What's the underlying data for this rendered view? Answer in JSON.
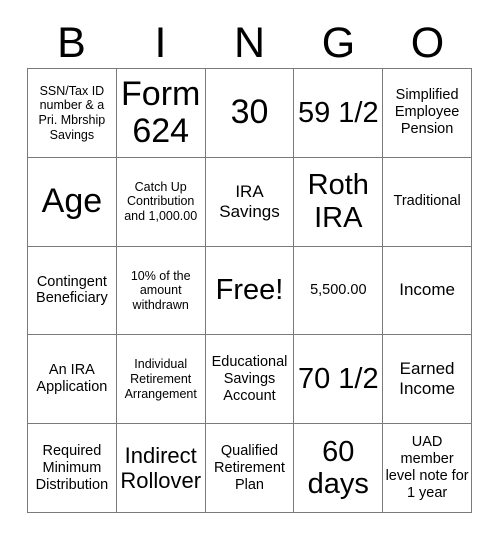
{
  "card": {
    "title": "BINGO Card",
    "header_letters": [
      "B",
      "I",
      "N",
      "G",
      "O"
    ],
    "free_space_label": "Free!",
    "colors": {
      "background": "#ffffff",
      "text": "#000000",
      "grid_line": "#7a7a7a"
    },
    "grid": {
      "columns": 5,
      "rows": 5,
      "cells": [
        [
          {
            "text": "SSN/Tax ID number & a Pri. Mbrship Savings",
            "size": "xs",
            "free": false
          },
          {
            "text": "Form 624",
            "size": "xxl",
            "free": false
          },
          {
            "text": "30",
            "size": "xxl",
            "free": false
          },
          {
            "text": "59 1/2",
            "size": "xl",
            "free": false
          },
          {
            "text": "Simplified Employee Pension",
            "size": "s",
            "free": false
          }
        ],
        [
          {
            "text": "Age",
            "size": "xxl",
            "free": false
          },
          {
            "text": "Catch Up Contribution and 1,000.00",
            "size": "xs",
            "free": false
          },
          {
            "text": "IRA Savings",
            "size": "m",
            "free": false
          },
          {
            "text": "Roth IRA",
            "size": "xl",
            "free": false
          },
          {
            "text": "Traditional",
            "size": "s",
            "free": false
          }
        ],
        [
          {
            "text": "Contingent Beneficiary",
            "size": "s",
            "free": false
          },
          {
            "text": "10% of the amount withdrawn",
            "size": "xs",
            "free": false
          },
          {
            "text": "Free!",
            "size": "xl",
            "free": true
          },
          {
            "text": "5,500.00",
            "size": "s",
            "free": false
          },
          {
            "text": "Income",
            "size": "m",
            "free": false
          }
        ],
        [
          {
            "text": "An IRA Application",
            "size": "s",
            "free": false
          },
          {
            "text": "Individual Retirement Arrangement",
            "size": "xs",
            "free": false
          },
          {
            "text": "Educational Savings Account",
            "size": "s",
            "free": false
          },
          {
            "text": "70 1/2",
            "size": "xl",
            "free": false
          },
          {
            "text": "Earned Income",
            "size": "m",
            "free": false
          }
        ],
        [
          {
            "text": "Required Minimum Distribution",
            "size": "s",
            "free": false
          },
          {
            "text": "Indirect Rollover",
            "size": "l",
            "free": false
          },
          {
            "text": "Qualified Retirement Plan",
            "size": "s",
            "free": false
          },
          {
            "text": "60 days",
            "size": "xl",
            "free": false
          },
          {
            "text": "UAD member level note for 1 year",
            "size": "s",
            "free": false
          }
        ]
      ]
    }
  }
}
